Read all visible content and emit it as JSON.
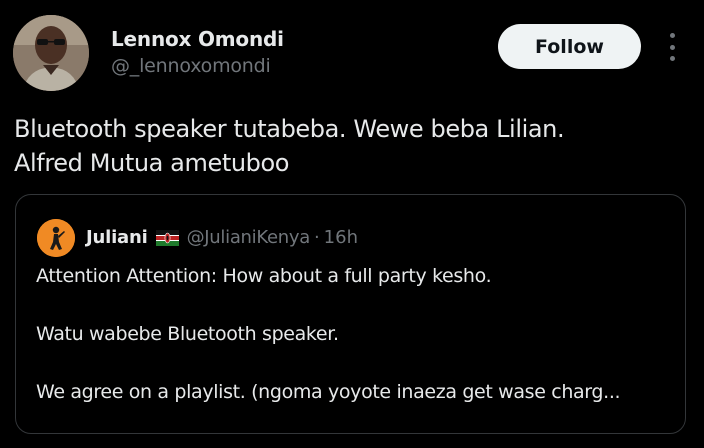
{
  "author": {
    "name": "Lennox Omondi",
    "handle": "@_lennoxomondi",
    "avatar_icon": "profile-photo"
  },
  "follow_label": "Follow",
  "more_icon": "more-vertical-icon",
  "tweet": {
    "lines": [
      "Bluetooth speaker tutabeba. Wewe beba Lilian.",
      "Alfred Mutua ametuboo"
    ]
  },
  "quote": {
    "name": "Juliani",
    "flag_icon": "kenya-flag-icon",
    "handle": "@JulianiKenya",
    "separator": "·",
    "time": "16h",
    "lines": [
      "Attention Attention: How about a full party kesho.",
      "Watu wabebe Bluetooth speaker.",
      "We agree on a playlist. (ngoma yoyote inaeza get wase charg..."
    ]
  },
  "colors": {
    "background": "#000000",
    "primary_text": "#e7e9ea",
    "secondary_text": "#71767b",
    "follow_bg": "#eff3f4",
    "follow_text": "#0f1419",
    "card_border": "#333639",
    "quote_avatar_bg": "#f08a24"
  }
}
